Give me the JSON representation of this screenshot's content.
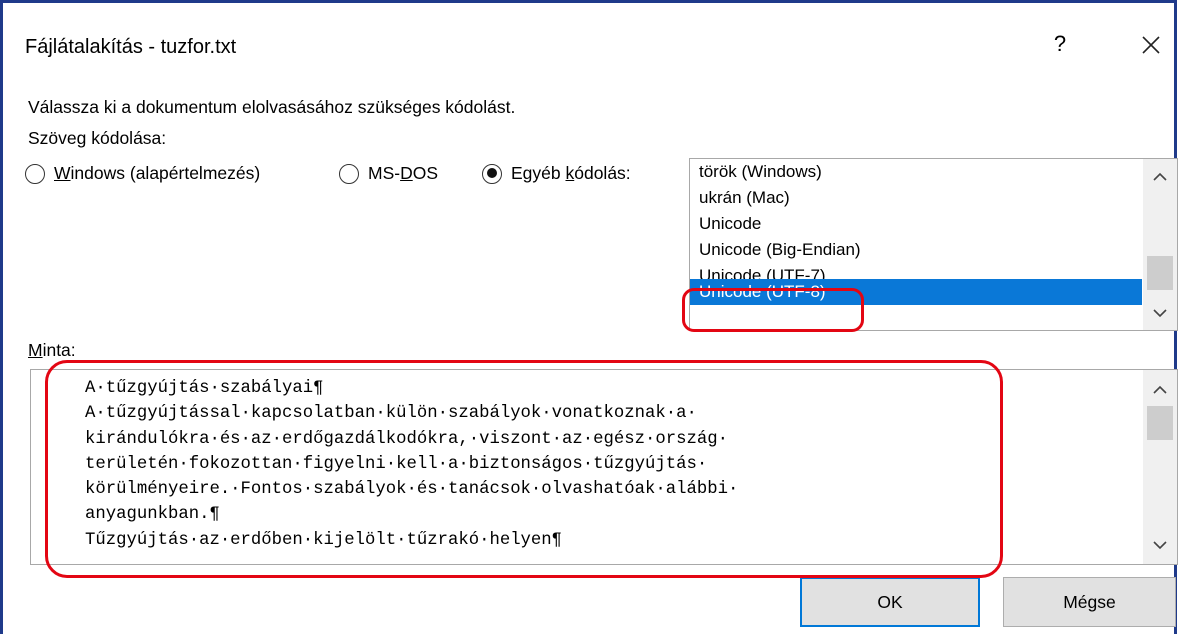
{
  "dialog": {
    "title": "Fájlátalakítás - tuzfor.txt",
    "help": "?",
    "instruction": "Válassza ki a dokumentum elolvasásához szükséges kódolást.",
    "encoding_label": "Szöveg kódolása:"
  },
  "radios": [
    {
      "accel": "W",
      "rest": "indows (alapértelmezés)",
      "checked": false
    },
    {
      "pre": "MS-",
      "accel": "D",
      "rest": "OS",
      "checked": false
    },
    {
      "pre": "Egyéb ",
      "accel": "k",
      "rest": "ódolás:",
      "checked": true
    }
  ],
  "encodings": [
    "török (Windows)",
    "ukrán (Mac)",
    "Unicode",
    "Unicode (Big-Endian)",
    "Unicode (UTF-7)",
    "Unicode (UTF-8)"
  ],
  "selected_encoding": "Unicode (UTF-8)",
  "sample": {
    "label_accel": "M",
    "label_rest": "inta:",
    "lines": [
      "A·tűzgyújtás·szabályai¶",
      "A·tűzgyújtással·kapcsolatban·külön·szabályok·vonatkoznak·a·",
      "kirándulókra·és·az·erdőgazdálkodókra,·viszont·az·egész·ország·",
      "területén·fokozottan·figyelni·kell·a·biztonságos·tűzgyújtás·",
      "körülményeire.·Fontos·szabályok·és·tanácsok·olvashatóak·alábbi·",
      "anyagunkban.¶",
      "Tűzgyújtás·az·erdőben·kijelölt·tűzrakó·helyen¶"
    ]
  },
  "buttons": {
    "ok": "OK",
    "cancel": "Mégse"
  },
  "colors": {
    "selection": "#0a78d7",
    "highlight": "#e30613",
    "frame": "#1f3a8a"
  }
}
